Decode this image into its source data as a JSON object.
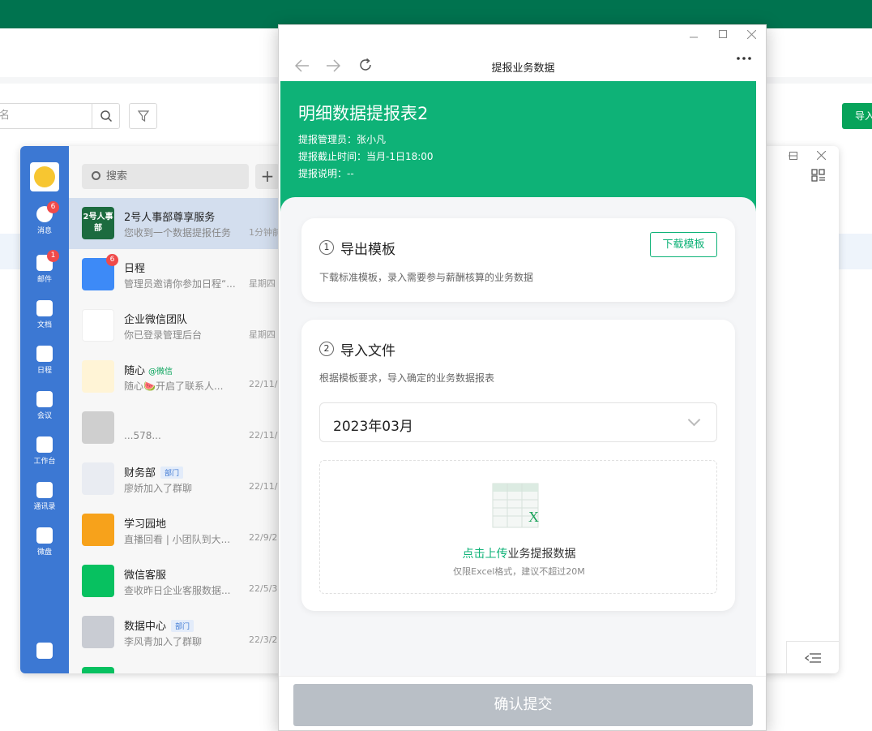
{
  "background": {
    "search_placeholder": "名",
    "import_button": "导入"
  },
  "wecom": {
    "nav": [
      {
        "label": "消息",
        "badge": "6"
      },
      {
        "label": "邮件",
        "badge": "1"
      },
      {
        "label": "文档",
        "badge": ""
      },
      {
        "label": "日程",
        "badge": ""
      },
      {
        "label": "会议",
        "badge": ""
      },
      {
        "label": "工作台",
        "badge": ""
      },
      {
        "label": "通讯录",
        "badge": ""
      },
      {
        "label": "微盘",
        "badge": ""
      }
    ],
    "search_placeholder": "搜索",
    "plus": "+",
    "chats": [
      {
        "name": "2号人事部尊享服务",
        "preview": "您收到一个数据提报任务",
        "time": "1分钟前",
        "avatar_text": "2号人事部",
        "avatar_color": "#1c6b3f"
      },
      {
        "name": "日程",
        "preview": "管理员邀请你参加日程“...",
        "time": "星期四",
        "badge": "6",
        "avatar_color": "#3d8af7"
      },
      {
        "name": "企业微信团队",
        "preview": "你已登录管理后台",
        "time": "星期四",
        "avatar_color": "#ffffff"
      },
      {
        "name": "随心",
        "tag_wx": "@微信",
        "preview": "随心🍉开启了联系人...",
        "time": "22/11/",
        "avatar_color": "#fff4d6"
      },
      {
        "name": "",
        "preview": "...578...",
        "time": "22/11/",
        "avatar_color": "#cfcfcf"
      },
      {
        "name": "财务部",
        "tag": "部门",
        "preview": "廖娇加入了群聊",
        "time": "22/11/",
        "avatar_color": "#e9ecf2"
      },
      {
        "name": "学习园地",
        "preview": "直播回看 | 小团队到大...",
        "time": "22/9/2",
        "avatar_color": "#f7a21b"
      },
      {
        "name": "微信客服",
        "preview": "查收昨日企业客服数据...",
        "time": "22/5/3",
        "avatar_color": "#07c160"
      },
      {
        "name": "数据中心",
        "tag": "部门",
        "preview": "李风青加入了群聊",
        "time": "22/3/2",
        "avatar_color": "#c9ccd3"
      },
      {
        "name": "",
        "preview": "",
        "time": "",
        "avatar_color": "#07c160"
      }
    ]
  },
  "dialog": {
    "title": "提报业务数据",
    "form_title": "明细数据提报表2",
    "manager": "提报管理员：张小凡",
    "deadline": "提报截止时间：当月-1日18:00",
    "note": "提报说明：--",
    "step1": {
      "num": "1",
      "title": "导出模板",
      "button": "下载模板",
      "desc": "下载标准模板，录入需要参与薪酬核算的业务数据"
    },
    "step2": {
      "num": "2",
      "title": "导入文件",
      "desc": "根据模板要求，导入确定的业务数据报表",
      "month": "2023年03月",
      "upload_link": "点击上传",
      "upload_text": "业务提报数据",
      "upload_hint": "仅限Excel格式，建议不超过20M"
    },
    "submit": "确认提交"
  },
  "colors": {
    "brand_green": "#0eb277",
    "wecom_blue": "#3c78d3",
    "top_bar": "#00734f"
  }
}
